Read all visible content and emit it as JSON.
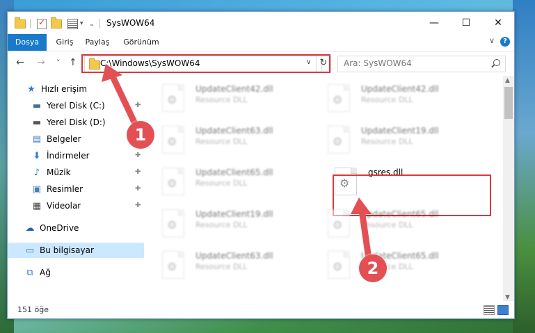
{
  "window": {
    "title": "SysWOW64",
    "minimize_glyph": "—",
    "maximize_glyph": "☐",
    "close_glyph": "✕"
  },
  "ribbon": {
    "tabs": [
      "Dosya",
      "Giriş",
      "Paylaş",
      "Görünüm"
    ],
    "help_glyph": "?",
    "collapse_glyph": "∨"
  },
  "navigation": {
    "back_glyph": "←",
    "forward_glyph": "→",
    "recent_glyph": "˅",
    "up_glyph": "↑",
    "address": "C:\\Windows\\SysWOW64",
    "address_dropdown_glyph": "∨",
    "refresh_glyph": "↻",
    "search_placeholder": "Ara: SysWOW64"
  },
  "sidebar": {
    "items": [
      {
        "label": "Hızlı erişim",
        "icon": "star-icon",
        "glyph": "★",
        "color": "#2b79d6",
        "pinned": false
      },
      {
        "label": "Yerel Disk (C:)",
        "icon": "drive-icon",
        "glyph": "▬",
        "color": "#4a6e9a",
        "pinned": true
      },
      {
        "label": "Yerel Disk (D:)",
        "icon": "drive-icon",
        "glyph": "▬",
        "color": "#555555",
        "pinned": true
      },
      {
        "label": "Belgeler",
        "icon": "documents-icon",
        "glyph": "▤",
        "color": "#4a7cc2",
        "pinned": true
      },
      {
        "label": "İndirmeler",
        "icon": "download-icon",
        "glyph": "⬇",
        "color": "#2b79d6",
        "pinned": true
      },
      {
        "label": "Müzik",
        "icon": "music-icon",
        "glyph": "♪",
        "color": "#2b79d6",
        "pinned": true
      },
      {
        "label": "Resimler",
        "icon": "pictures-icon",
        "glyph": "▣",
        "color": "#4a7cc2",
        "pinned": true
      },
      {
        "label": "Videolar",
        "icon": "video-icon",
        "glyph": "▦",
        "color": "#444444",
        "pinned": true
      },
      {
        "label": "OneDrive",
        "icon": "cloud-icon",
        "glyph": "☁",
        "color": "#1f64b5",
        "pinned": false
      },
      {
        "label": "Bu bilgisayar",
        "icon": "computer-icon",
        "glyph": "▭",
        "color": "#2b79d6",
        "pinned": false
      },
      {
        "label": "Ağ",
        "icon": "network-icon",
        "glyph": "⧉",
        "color": "#2b79d6",
        "pinned": false
      }
    ],
    "pin_glyph": "📌"
  },
  "files": [
    {
      "name": "UpdateClient42.dll",
      "type": "Resource DLL"
    },
    {
      "name": "UpdateClient42.dll",
      "type": "Resource DLL"
    },
    {
      "name": "UpdateClient63.dll",
      "type": "Resource DLL"
    },
    {
      "name": "UpdateClient19.dll",
      "type": "Resource DLL"
    },
    {
      "name": "UpdateClient65.dll",
      "type": "Resource DLL"
    },
    {
      "name": "gsres.dll",
      "type": ""
    },
    {
      "name": "UpdateClient19.dll",
      "type": "Resource DLL"
    },
    {
      "name": "UpdateClient65.dll",
      "type": "Resource DLL"
    },
    {
      "name": "UpdateClient63.dll",
      "type": "Resource DLL"
    },
    {
      "name": "UpdateClient65.dll",
      "type": "Resource DLL"
    }
  ],
  "status": {
    "item_count": "151 öğe"
  },
  "annotations": {
    "badge_1": "1",
    "badge_2": "2",
    "highlight_color": "#d6393f"
  }
}
